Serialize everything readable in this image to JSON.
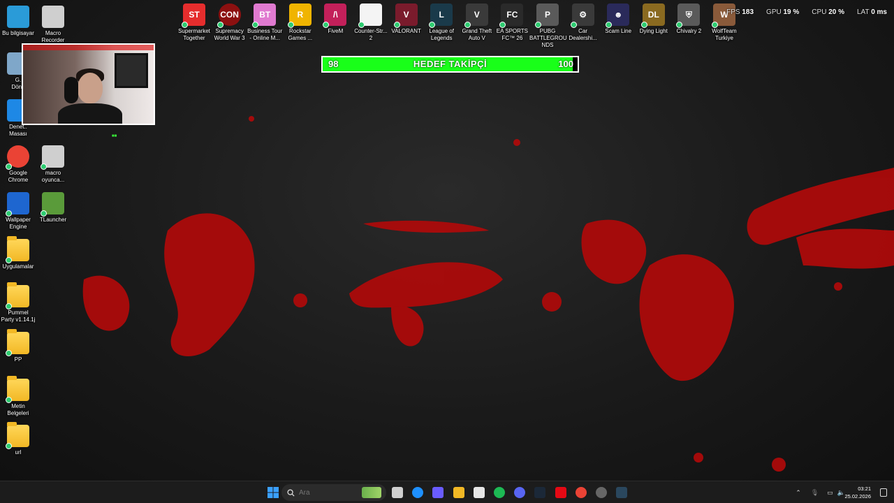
{
  "desktop_left": [
    {
      "label": "Bu bilgisayar",
      "icon": "monitor-icon",
      "color": "#2a9bd8"
    },
    {
      "label": "Macro\nRecorder",
      "icon": "robot-icon",
      "color": "#cfcfcf"
    },
    {
      "label": "G.\nDönü",
      "icon": "recycle-bin-icon",
      "color": "#7fa7c9"
    },
    {
      "label": "Denet..\nMasası",
      "icon": "control-panel-icon",
      "color": "#1e88e5"
    },
    {
      "label": "Google\nChrome",
      "icon": "chrome-icon",
      "color": "#ea4335"
    },
    {
      "label": "macro\noyunca...",
      "icon": "robot-icon",
      "color": "#cfcfcf"
    },
    {
      "label": "Wallpaper\nEngine",
      "icon": "wallpaper-engine-icon",
      "color": "#1e66d0"
    },
    {
      "label": "TLauncher",
      "icon": "minecraft-block-icon",
      "color": "#5a9b3a"
    },
    {
      "label": "Uygulamalar",
      "icon": "folder-icon",
      "color": "#f2b825"
    },
    {
      "label": "Pummel\nParty v1.14.1j",
      "icon": "folder-icon",
      "color": "#f2b825"
    },
    {
      "label": "PP",
      "icon": "folder-icon",
      "color": "#f2b825"
    },
    {
      "label": "Metin\nBelgeleri",
      "icon": "folder-icon",
      "color": "#f2b825"
    },
    {
      "label": "url",
      "icon": "folder-icon",
      "color": "#f2b825"
    }
  ],
  "desktop_top": [
    {
      "label": "Supermarket\nTogether",
      "glyph": "ST",
      "icon": "supermarket-together-icon",
      "color": "#e52d2d"
    },
    {
      "label": "Supremacy\nWorld War 3",
      "glyph": "CON",
      "icon": "supremacy-icon",
      "color": "#8c1010"
    },
    {
      "label": "Business Tour\n- Online M...",
      "glyph": "BT",
      "icon": "business-tour-icon",
      "color": "#e07ad0"
    },
    {
      "label": "Rockstar\nGames ...",
      "glyph": "R",
      "icon": "rockstar-icon",
      "color": "#f0b400"
    },
    {
      "label": "FiveM",
      "glyph": "/\\",
      "icon": "fivem-icon",
      "color": "#c3205a"
    },
    {
      "label": "Counter-Str...\n2",
      "glyph": "",
      "icon": "file-icon",
      "color": "#f4f4f4"
    },
    {
      "label": "VALORANT",
      "glyph": "V",
      "icon": "valorant-icon",
      "color": "#7a1b2c"
    },
    {
      "label": "League of\nLegends",
      "glyph": "L",
      "icon": "league-icon",
      "color": "#1a3a4a"
    },
    {
      "label": "Grand Theft\nAuto V",
      "glyph": "V",
      "icon": "gta-icon",
      "color": "#3a3a3a"
    },
    {
      "label": "EA SPORTS\nFC™ 26",
      "glyph": "FC",
      "icon": "ea-fc-icon",
      "color": "#2a2a2a"
    },
    {
      "label": "PUBG\nBATTLEGROU\nNDS",
      "glyph": "P",
      "icon": "pubg-icon",
      "color": "#5a5a5a"
    },
    {
      "label": "Car\nDealershi...",
      "glyph": "⚙",
      "icon": "car-dealership-icon",
      "color": "#3a3a3a"
    },
    {
      "label": "Scam Line",
      "glyph": "☻",
      "icon": "scam-line-icon",
      "color": "#2a2a5a"
    },
    {
      "label": "Dying Light",
      "glyph": "DL",
      "icon": "dying-light-icon",
      "color": "#8a6a20"
    },
    {
      "label": "Chivalry 2",
      "glyph": "⛨",
      "icon": "chivalry-icon",
      "color": "#5a5a5a"
    },
    {
      "label": "WolfTeam\nTurkiye",
      "glyph": "W",
      "icon": "wolfteam-icon",
      "color": "#8a5a3a"
    }
  ],
  "progress": {
    "current": "98",
    "title": "HEDEF TAKİPÇİ",
    "target": "100",
    "fill_fraction": 0.98,
    "color": "#19ff19"
  },
  "webcam_tag": "■■",
  "stats": {
    "fps_label": "FPS",
    "fps": "183",
    "gpu_label": "GPU",
    "gpu": "19 %",
    "cpu_label": "CPU",
    "cpu": "20 %",
    "lat_label": "LAT",
    "lat": "0 ms"
  },
  "taskbar": {
    "search_placeholder": "Ara",
    "apps": [
      {
        "icon": "task-view-icon",
        "color": "#cfcfcf"
      },
      {
        "icon": "edge-icon",
        "color": "#1e90ff"
      },
      {
        "icon": "copilot-icon",
        "color": "#6a5cff"
      },
      {
        "icon": "file-explorer-icon",
        "color": "#f2b825"
      },
      {
        "icon": "store-icon",
        "color": "#e6e6e6"
      },
      {
        "icon": "spotify-icon",
        "color": "#1db954"
      },
      {
        "icon": "discord-icon",
        "color": "#5865f2"
      },
      {
        "icon": "steam-icon",
        "color": "#1b2838"
      },
      {
        "icon": "netflix-icon",
        "color": "#e50914"
      },
      {
        "icon": "chrome-icon",
        "color": "#ea4335"
      },
      {
        "icon": "obs-icon",
        "color": "#666666"
      },
      {
        "icon": "steam-icon",
        "color": "#2a475e"
      }
    ],
    "time": "03:21",
    "date": "25.02.2026"
  }
}
